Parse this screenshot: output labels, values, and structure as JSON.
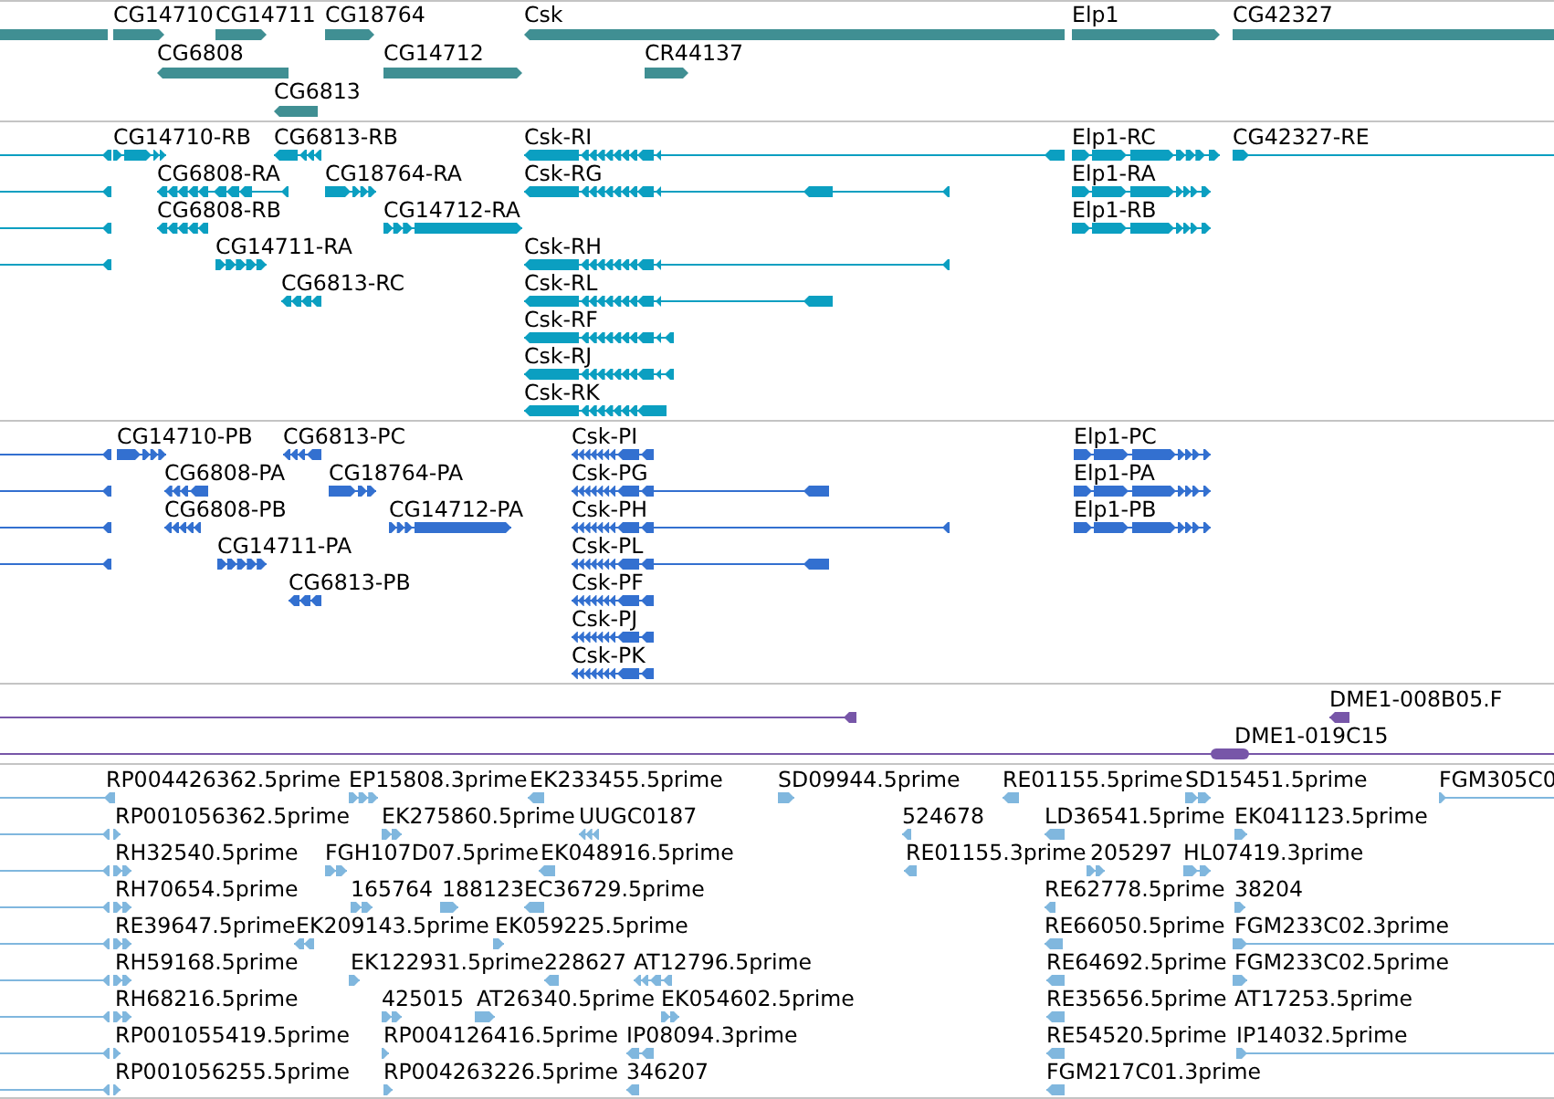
{
  "tracks": [
    {
      "kind": "gene",
      "features": [
        {
          "kind": "plain"
        },
        {
          "label": "CG14710",
          "kind": "forward"
        },
        {
          "label": "CG14711",
          "kind": "forward"
        },
        {
          "label": "CG18764",
          "kind": "forward"
        },
        {
          "label": "Csk",
          "kind": "reverse"
        },
        {
          "label": "Elp1",
          "kind": "forward"
        },
        {
          "label": "CG42327",
          "kind": "plain"
        },
        {
          "label": "CG6808",
          "kind": "reverse"
        },
        {
          "label": "CG14712",
          "kind": "forward"
        },
        {
          "label": "CR44137",
          "kind": "forward"
        },
        {
          "label": "CG6813",
          "kind": "reverse"
        }
      ]
    },
    {
      "kind": "transcript",
      "features": [
        {
          "kind": "reverse"
        },
        {
          "label": "CG14710-RB",
          "kind": "forward"
        },
        {
          "label": "CG6813-RB",
          "kind": "reverse"
        },
        {
          "label": "Csk-RI",
          "kind": "reverse"
        },
        {
          "label": "Elp1-RC",
          "kind": "forward"
        },
        {
          "label": "CG42327-RE",
          "kind": "forward"
        },
        {
          "kind": "reverse"
        },
        {
          "label": "CG6808-RA",
          "kind": "reverse"
        },
        {
          "label": "CG18764-RA",
          "kind": "forward"
        },
        {
          "label": "Csk-RG",
          "kind": "reverse"
        },
        {
          "label": "Elp1-RA",
          "kind": "forward"
        },
        {
          "kind": "reverse"
        },
        {
          "label": "CG6808-RB",
          "kind": "reverse"
        },
        {
          "label": "CG14712-RA",
          "kind": "forward"
        },
        {
          "label": "Elp1-RB",
          "kind": "forward"
        },
        {
          "kind": "reverse"
        },
        {
          "label": "CG14711-RA",
          "kind": "forward"
        },
        {
          "label": "Csk-RH",
          "kind": "reverse"
        },
        {
          "label": "CG6813-RC",
          "kind": "reverse"
        },
        {
          "label": "Csk-RL",
          "kind": "reverse"
        },
        {
          "label": "Csk-RF",
          "kind": "reverse"
        },
        {
          "label": "Csk-RJ",
          "kind": "reverse"
        },
        {
          "label": "Csk-RK",
          "kind": "reverse"
        }
      ]
    },
    {
      "kind": "protein",
      "features": [
        {
          "kind": "reverse"
        },
        {
          "label": "CG14710-PB",
          "kind": "forward"
        },
        {
          "label": "CG6813-PC",
          "kind": "reverse"
        },
        {
          "label": "Csk-PI",
          "kind": "reverse"
        },
        {
          "label": "Elp1-PC",
          "kind": "forward"
        },
        {
          "kind": "reverse"
        },
        {
          "label": "CG6808-PA",
          "kind": "reverse"
        },
        {
          "label": "CG18764-PA",
          "kind": "forward"
        },
        {
          "label": "Csk-PG",
          "kind": "reverse"
        },
        {
          "label": "Elp1-PA",
          "kind": "forward"
        },
        {
          "kind": "reverse"
        },
        {
          "label": "CG6808-PB",
          "kind": "reverse"
        },
        {
          "label": "CG14712-PA",
          "kind": "forward"
        },
        {
          "label": "Csk-PH",
          "kind": "reverse"
        },
        {
          "label": "Elp1-PB",
          "kind": "forward"
        },
        {
          "kind": "reverse"
        },
        {
          "label": "CG14711-PA",
          "kind": "forward"
        },
        {
          "label": "Csk-PL",
          "kind": "reverse"
        },
        {
          "label": "CG6813-PB",
          "kind": "reverse"
        },
        {
          "label": "Csk-PF",
          "kind": "reverse"
        },
        {
          "label": "Csk-PJ",
          "kind": "reverse"
        },
        {
          "label": "Csk-PK",
          "kind": "reverse"
        }
      ]
    },
    {
      "kind": "clone",
      "features": [
        {
          "kind": "reverse"
        },
        {
          "label": "DME1-008B05.F",
          "kind": "reverse"
        },
        {
          "label": "DME1-019C15",
          "kind": "plain"
        }
      ]
    },
    {
      "kind": "est",
      "features": [
        {
          "label": "RP004426362.5prime",
          "kind": "reverse"
        },
        {
          "label": "EP15808.3prime",
          "kind": "forward"
        },
        {
          "label": "EK233455.5prime",
          "kind": "reverse"
        },
        {
          "label": "SD09944.5prime",
          "kind": "forward"
        },
        {
          "label": "RE01155.5prime",
          "kind": "reverse"
        },
        {
          "label": "SD15451.5prime",
          "kind": "forward"
        },
        {
          "label": "FGM305C0",
          "kind": "forward"
        },
        {
          "kind": "reverse"
        },
        {
          "label": "RP001056362.5prime",
          "kind": "forward"
        },
        {
          "label": "EK275860.5prime",
          "kind": "forward"
        },
        {
          "label": "UUGC0187",
          "kind": "reverse"
        },
        {
          "label": "524678",
          "kind": "reverse"
        },
        {
          "label": "LD36541.5prime",
          "kind": "reverse"
        },
        {
          "label": "EK041123.5prime",
          "kind": "forward"
        },
        {
          "kind": "reverse"
        },
        {
          "label": "RH32540.5prime",
          "kind": "forward"
        },
        {
          "label": "FGH107D07.5prime",
          "kind": "forward"
        },
        {
          "label": "EK048916.5prime",
          "kind": "reverse"
        },
        {
          "label": "RE01155.3prime",
          "kind": "reverse"
        },
        {
          "label": "205297",
          "kind": "forward"
        },
        {
          "label": "HL07419.3prime",
          "kind": "forward"
        },
        {
          "kind": "reverse"
        },
        {
          "label": "RH70654.5prime",
          "kind": "forward"
        },
        {
          "label": "165764",
          "kind": "forward"
        },
        {
          "label": "188123",
          "kind": "forward"
        },
        {
          "label": "EC36729.5prime",
          "kind": "reverse"
        },
        {
          "label": "RE62778.5prime",
          "kind": "reverse"
        },
        {
          "label": "38204",
          "kind": "forward"
        },
        {
          "kind": "reverse"
        },
        {
          "label": "RE39647.5prime",
          "kind": "forward"
        },
        {
          "label": "EK209143.5prime",
          "kind": "reverse"
        },
        {
          "label": "EK059225.5prime",
          "kind": "forward"
        },
        {
          "label": "RE66050.5prime",
          "kind": "reverse"
        },
        {
          "label": "FGM233C02.3prime",
          "kind": "forward"
        },
        {
          "kind": "reverse"
        },
        {
          "label": "RH59168.5prime",
          "kind": "forward"
        },
        {
          "label": "EK122931.5prime",
          "kind": "forward"
        },
        {
          "label": "228627",
          "kind": "reverse"
        },
        {
          "label": "AT12796.5prime",
          "kind": "reverse"
        },
        {
          "label": "RE64692.5prime",
          "kind": "reverse"
        },
        {
          "label": "FGM233C02.5prime",
          "kind": "forward"
        },
        {
          "kind": "reverse"
        },
        {
          "label": "RH68216.5prime",
          "kind": "forward"
        },
        {
          "label": "425015",
          "kind": "forward"
        },
        {
          "label": "AT26340.5prime",
          "kind": "forward"
        },
        {
          "label": "EK054602.5prime",
          "kind": "forward"
        },
        {
          "label": "RE35656.5prime",
          "kind": "reverse"
        },
        {
          "label": "AT17253.5prime"
        },
        {
          "kind": "reverse"
        },
        {
          "label": "RP001055419.5prime",
          "kind": "forward"
        },
        {
          "label": "RP004126416.5prime",
          "kind": "forward"
        },
        {
          "label": "IP08094.3prime",
          "kind": "reverse"
        },
        {
          "label": "RE54520.5prime",
          "kind": "reverse"
        },
        {
          "label": "IP14032.5prime",
          "kind": "forward"
        },
        {
          "kind": "reverse"
        },
        {
          "label": "RP001056255.5prime",
          "kind": "forward"
        },
        {
          "label": "RP004263226.5prime",
          "kind": "forward"
        },
        {
          "label": "346207",
          "kind": "reverse"
        },
        {
          "label": "FGM217C01.3prime",
          "kind": "reverse"
        }
      ]
    }
  ]
}
